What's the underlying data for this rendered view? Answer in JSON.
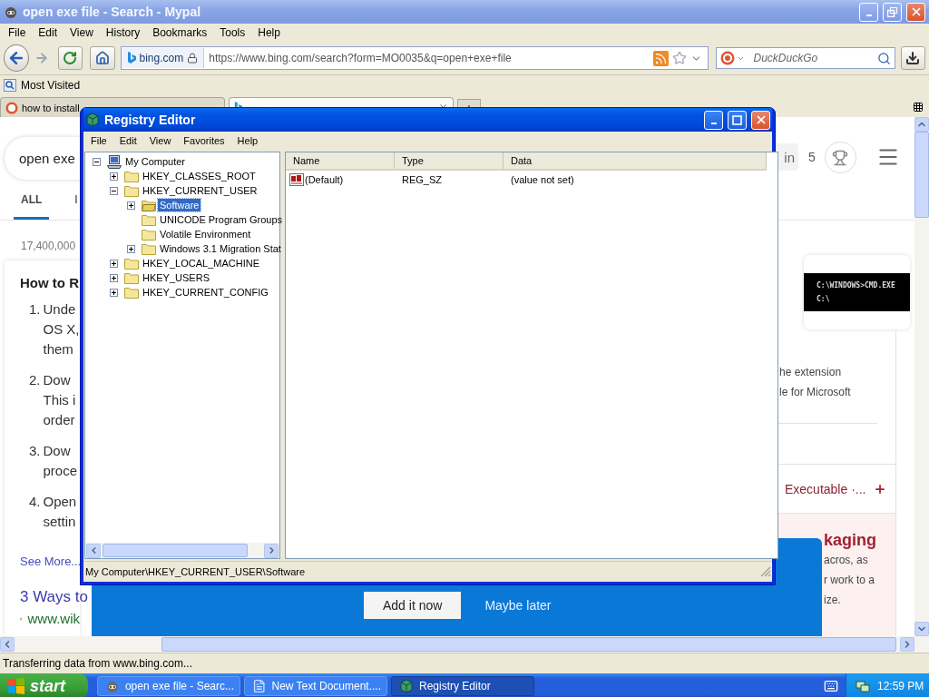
{
  "browser": {
    "title": "open exe file - Search - Mypal",
    "menu": [
      "File",
      "Edit",
      "View",
      "History",
      "Bookmarks",
      "Tools",
      "Help"
    ],
    "identity": "bing.com",
    "url": "https://www.bing.com/search?form=MO0035&q=open+exe+file",
    "search": {
      "placeholder": "DuckDuckGo"
    },
    "bookmarks": [
      "Most Visited"
    ],
    "tabs": [
      {
        "label": "how to install",
        "selected": false
      },
      {
        "selected": true
      }
    ],
    "status": "Transferring data from www.bing.com..."
  },
  "page": {
    "search_value": "open exe",
    "nav": [
      {
        "label": "ALL",
        "selected": true
      },
      {
        "label": "I",
        "selected": false
      }
    ],
    "count": "17,400,000",
    "answer": {
      "title": "How to R",
      "steps": [
        {
          "number": "1.",
          "lines": [
            "Unde",
            "OS X,",
            "them"
          ]
        },
        {
          "number": "2.",
          "lines": [
            "Dow",
            "This i",
            "order"
          ]
        },
        {
          "number": "3.",
          "lines": [
            "Dow",
            "proce"
          ]
        },
        {
          "number": "4.",
          "lines": [
            "Open",
            "settin"
          ]
        }
      ],
      "see_more": "See More..."
    },
    "result": {
      "title": "3 Ways to",
      "url": "www.wik"
    },
    "header_right": {
      "sign_in": "in",
      "points": "5"
    },
    "image_card": {
      "lines": [
        "C:\\WINDOWS>CMD.EXE",
        "C:\\"
      ]
    },
    "snippet": [
      "he extension",
      "le for Microsoft"
    ],
    "related": "Executable ·...",
    "ad": {
      "title": "kaging",
      "lines": [
        "acros, as",
        "r work to a",
        "ize."
      ]
    }
  },
  "banner": {
    "buttons": [
      {
        "label": "Add it now",
        "kind": "primary"
      },
      {
        "label": "Maybe later",
        "kind": "link"
      }
    ]
  },
  "regedit": {
    "title": "Registry Editor",
    "menu": [
      "File",
      "Edit",
      "View",
      "Favorites",
      "Help"
    ],
    "tree": [
      {
        "label": "My Computer",
        "kind": "computer",
        "expanded": true,
        "selected": false,
        "children": [
          {
            "label": "HKEY_CLASSES_ROOT",
            "kind": "folder",
            "expanded": false,
            "selected": false
          },
          {
            "label": "HKEY_CURRENT_USER",
            "kind": "folder",
            "expanded": true,
            "selected": false,
            "children": [
              {
                "label": "Software",
                "kind": "folder",
                "expanded": false,
                "selected": true
              },
              {
                "label": "UNICODE Program Groups",
                "kind": "folder",
                "selected": false
              },
              {
                "label": "Volatile Environment",
                "kind": "folder",
                "selected": false
              },
              {
                "label": "Windows 3.1 Migration Stat",
                "kind": "folder",
                "expanded": false,
                "selected": false
              }
            ]
          },
          {
            "label": "HKEY_LOCAL_MACHINE",
            "kind": "folder",
            "expanded": false,
            "selected": false
          },
          {
            "label": "HKEY_USERS",
            "kind": "folder",
            "expanded": false,
            "selected": false
          },
          {
            "label": "HKEY_CURRENT_CONFIG",
            "kind": "folder",
            "expanded": false,
            "selected": false
          }
        ]
      }
    ],
    "columns": [
      "Name",
      "Type",
      "Data"
    ],
    "rows": [
      {
        "name": "(Default)",
        "type": "REG_SZ",
        "data": "(value not set)"
      }
    ],
    "status": "My Computer\\HKEY_CURRENT_USER\\Software"
  },
  "taskbar": {
    "start": "start",
    "tasks": [
      {
        "label": "open exe file - Searc...",
        "kind": "browser",
        "selected": false
      },
      {
        "label": "New Text Document....",
        "kind": "notepad",
        "selected": false
      },
      {
        "label": "Registry Editor",
        "kind": "regedit",
        "selected": true
      }
    ],
    "clock": "12:59 PM"
  }
}
